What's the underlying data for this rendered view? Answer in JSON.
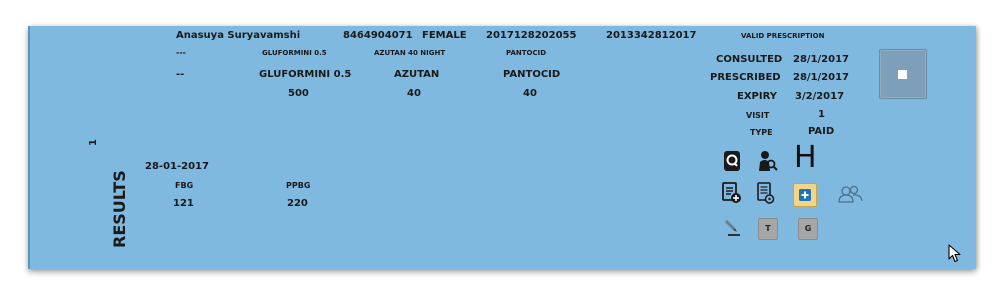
{
  "patient": {
    "name": "Anasuya Suryavamshi",
    "phone": "8464904071",
    "gender": "FEMALE",
    "id_1": "2017128202055",
    "id_2": "2013342812017",
    "visit_index": "1"
  },
  "prescription": {
    "status": "VALID PRESCRIPTION",
    "consulted_label": "CONSULTED",
    "consulted_value": "28/1/2017",
    "prescribed_label": "PRESCRIBED",
    "prescribed_value": "28/1/2017",
    "expiry_label": "EXPIRY",
    "expiry_value": "3/2/2017",
    "visit_label": "VISIT",
    "visit_value": "1",
    "type_label": "TYPE",
    "type_value": "PAID"
  },
  "medications": {
    "row1": [
      "---",
      "GLUFORMINI 0.5",
      "AZUTAN 40 NIGHT",
      "PANTOCID"
    ],
    "row2": [
      "--",
      "GLUFORMINI 0.5",
      "AZUTAN",
      "PANTOCID"
    ],
    "row3": [
      "500",
      "40",
      "40"
    ]
  },
  "results": {
    "section_label": "RESULTS",
    "date": "28-01-2017",
    "headers": [
      "FBG",
      "PPBG"
    ],
    "values": [
      "121",
      "220"
    ]
  },
  "actions": {
    "h_label": "H",
    "t_label": "T",
    "g_label": "G"
  },
  "icons": {
    "q": "search-document-icon",
    "user_search": "user-search-icon",
    "h": "hospital-icon",
    "add_doc": "add-document-icon",
    "doc_settings": "document-settings-icon",
    "add_box": "add-box-icon",
    "users": "users-icon",
    "pen": "pen-icon",
    "stop": "stop-icon",
    "cursor": "mouse-cursor-icon"
  },
  "colors": {
    "panel_bg": "#7fb9e0",
    "text": "#1a1a1a",
    "button_bg": "#7e9fba"
  }
}
